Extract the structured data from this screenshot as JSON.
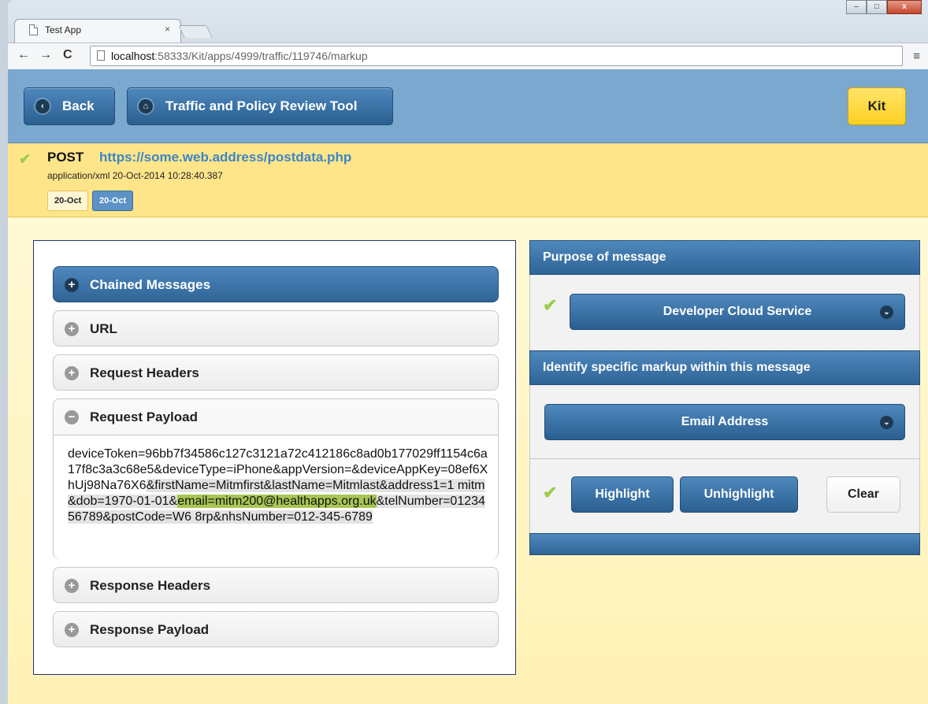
{
  "browser": {
    "tab_title": "Test App",
    "tab_close": "×",
    "address_host": "localhost",
    "address_path": ":58333/Kit/apps/4999/traffic/119746/markup",
    "back_glyph": "←",
    "forward_glyph": "→",
    "reload_glyph": "C",
    "menu_glyph": "≡",
    "minimize_glyph": "–",
    "maximize_glyph": "□",
    "close_glyph": "x"
  },
  "header": {
    "back_label": "Back",
    "tool_label": "Traffic and Policy Review Tool",
    "kit_label": "Kit"
  },
  "message": {
    "method": "POST",
    "url": "https://some.web.address/postdata.php",
    "meta": "application/xml  20-Oct-2014 10:28:40.387",
    "tags": [
      "20-Oct",
      "20-Oct"
    ]
  },
  "accordion": {
    "chained": "Chained Messages",
    "url": "URL",
    "request_headers": "Request Headers",
    "request_payload": "Request Payload",
    "response_headers": "Response Headers",
    "response_payload": "Response Payload",
    "payload": {
      "part1": "deviceToken=96bb7f34586c127c3121a72c412186c8ad0b177029ff1154c6a17f8c3a3c68e5&deviceType=iPhone&appVersion=&deviceAppKey=08ef6XhUj98Na76X6",
      "part2": "&firstName=Mitmfirst&lastName=Mitmlast&address1=1 mitm&dob=1970-01-01&",
      "part3": "email=mitm200@healthapps.org.uk",
      "part4": "&telNumber=0123456789&postCode=W6 8rp&nhsNumber=012-345-6789"
    }
  },
  "right": {
    "purpose_title": "Purpose of message",
    "purpose_value": "Developer Cloud Service",
    "markup_title": "Identify specific markup within this message",
    "markup_value": "Email Address",
    "highlight": "Highlight",
    "unhighlight": "Unhighlight",
    "clear": "Clear"
  },
  "icons": {
    "check": "✔",
    "plus": "+",
    "minus": "−",
    "chevron_down": "⌄",
    "chevron_left": "‹",
    "home": "⌂"
  },
  "colors": {
    "accent_blue": "#2f6496",
    "kit_yellow": "#fcd022",
    "email_highlight": "#a8c654",
    "check_green": "#9ccc4a"
  }
}
